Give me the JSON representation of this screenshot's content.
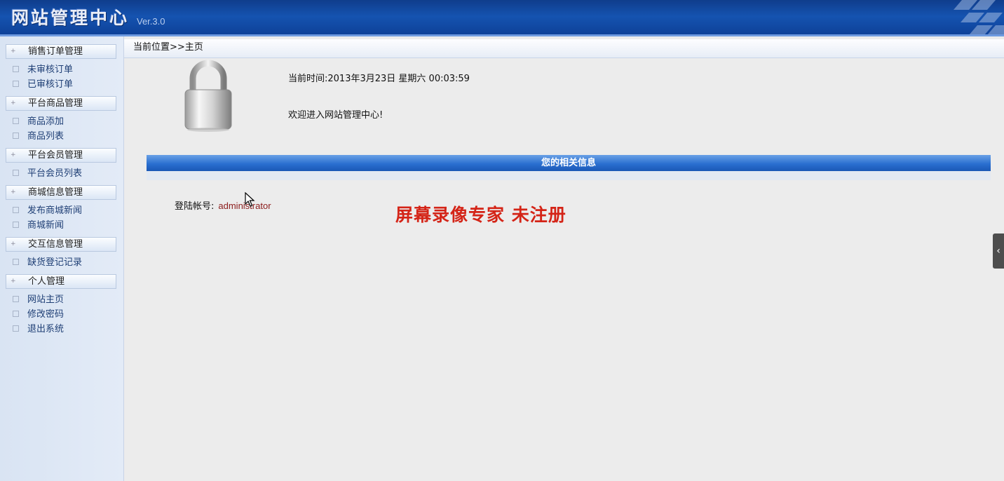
{
  "header": {
    "title": "网站管理中心",
    "version": "Ver.3.0"
  },
  "sidebar": {
    "groups": [
      {
        "label": "销售订单管理",
        "items": [
          "未审核订单",
          "已审核订单"
        ]
      },
      {
        "label": "平台商品管理",
        "items": [
          "商品添加",
          "商品列表"
        ]
      },
      {
        "label": "平台会员管理",
        "items": [
          "平台会员列表"
        ]
      },
      {
        "label": "商城信息管理",
        "items": [
          "发布商城新闻",
          "商城新闻"
        ]
      },
      {
        "label": "交互信息管理",
        "items": [
          "缺货登记记录"
        ]
      },
      {
        "label": "个人管理",
        "items": [
          "网站主页",
          "修改密码",
          "退出系统"
        ]
      }
    ]
  },
  "main": {
    "breadcrumb": "当前位置>>主页",
    "current_time": "当前时间:2013年3月23日 星期六 00:03:59",
    "welcome": "欢迎进入网站管理中心!",
    "info_bar": "您的相关信息",
    "account_label": "登陆帐号:",
    "account_value": "administrator"
  },
  "watermark": "屏幕录像专家  未注册",
  "colors": {
    "header_blue": "#1553b0",
    "info_bar_blue": "#2a6fd0",
    "watermark_red": "#d42417"
  }
}
